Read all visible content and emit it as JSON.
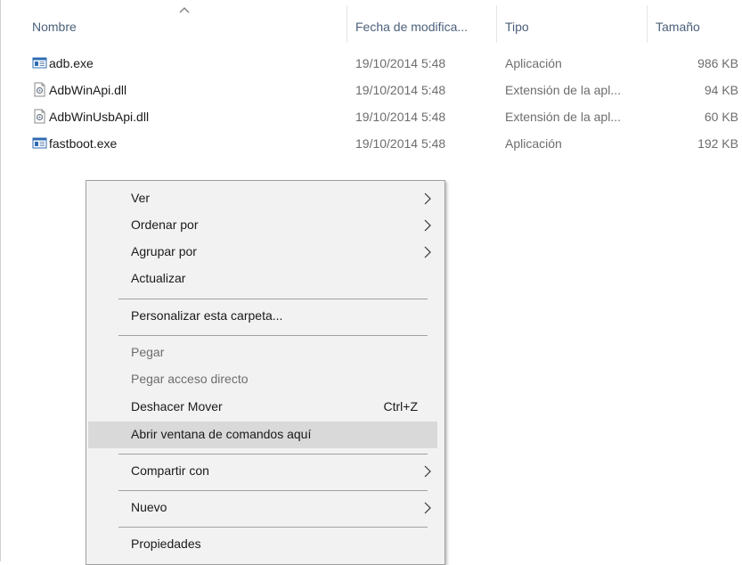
{
  "columns": {
    "name": "Nombre",
    "date": "Fecha de modifica...",
    "type": "Tipo",
    "size": "Tamaño"
  },
  "files": [
    {
      "name": "adb.exe",
      "date": "19/10/2014 5:48",
      "type": "Aplicación",
      "size": "986 KB",
      "icon": "application-icon"
    },
    {
      "name": "AdbWinApi.dll",
      "date": "19/10/2014 5:48",
      "type": "Extensión de la apl...",
      "size": "94 KB",
      "icon": "dll-file-icon"
    },
    {
      "name": "AdbWinUsbApi.dll",
      "date": "19/10/2014 5:48",
      "type": "Extensión de la apl...",
      "size": "60 KB",
      "icon": "dll-file-icon"
    },
    {
      "name": "fastboot.exe",
      "date": "19/10/2014 5:48",
      "type": "Aplicación",
      "size": "192 KB",
      "icon": "application-icon"
    }
  ],
  "context_menu": {
    "items": [
      {
        "label": "Ver",
        "submenu": true
      },
      {
        "label": "Ordenar por",
        "submenu": true
      },
      {
        "label": "Agrupar por",
        "submenu": true
      },
      {
        "label": "Actualizar"
      },
      {
        "label": "Personalizar esta carpeta..."
      },
      {
        "label": "Pegar",
        "disabled": true
      },
      {
        "label": "Pegar acceso directo",
        "disabled": true
      },
      {
        "label": "Deshacer Mover",
        "shortcut": "Ctrl+Z"
      },
      {
        "label": "Abrir ventana de comandos aquí",
        "highlighted": true
      },
      {
        "label": "Compartir con",
        "submenu": true
      },
      {
        "label": "Nuevo",
        "submenu": true
      },
      {
        "label": "Propiedades"
      }
    ]
  },
  "colors": {
    "header_text": "#4c607a",
    "menu_background": "#f2f2f2",
    "menu_highlight": "#d9d9d9",
    "disabled_text": "#6d6d6d"
  }
}
